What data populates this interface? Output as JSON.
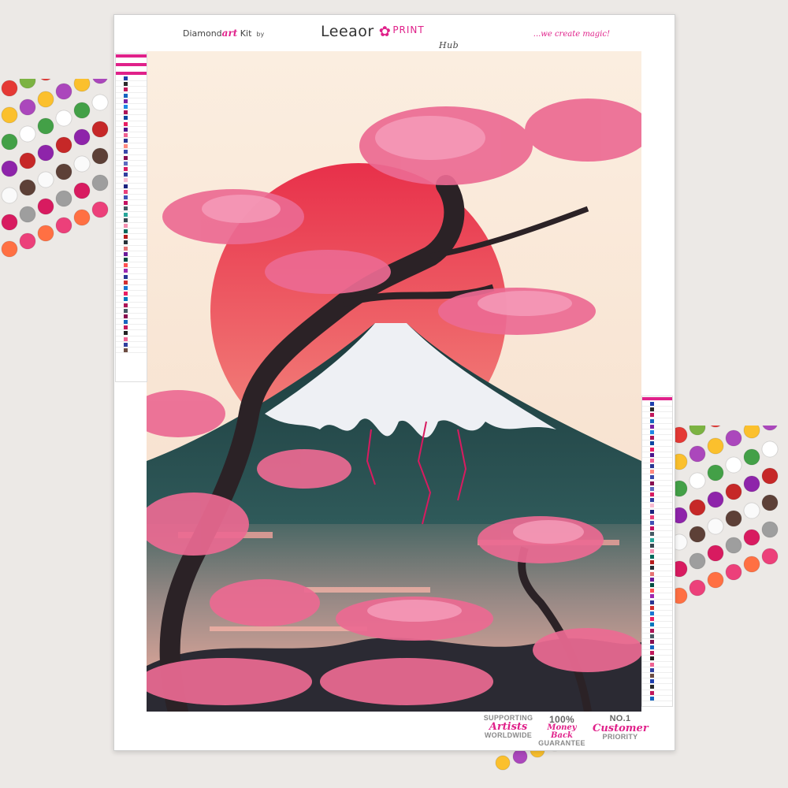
{
  "header": {
    "brand_left_prefix": "Diamond",
    "brand_left_art": "art",
    "brand_left_suffix": " Kit",
    "brand_left_by": "by",
    "brand_center_name": "Leeaor",
    "brand_center_print": "PRINT",
    "brand_center_hub": "Hub",
    "tagline": "...we create magic!"
  },
  "footer": {
    "badges": [
      {
        "top": "SUPPORTING",
        "mid": "Artists",
        "bottom": "WORLDWIDE"
      },
      {
        "top": "100%",
        "mid": "Money Back",
        "bottom": "GUARANTEE"
      },
      {
        "top": "NO.1",
        "mid": "Customer",
        "bottom": "PRIORITY"
      }
    ]
  },
  "colors": {
    "brand_pink": "#e0218a",
    "sky": "#f7e7d6",
    "sun": "#ea3e4f",
    "mountain_dark": "#234547",
    "snow": "#eef0f4",
    "blossom": "#ec6a92",
    "trunk": "#2b2226"
  },
  "legend_swatches": [
    "#1e3fae",
    "#2a2a2a",
    "#c2185b",
    "#1565c0",
    "#7b1fa2",
    "#1e88e5",
    "#ad1457",
    "#0d47a1",
    "#e91e63",
    "#4a148c",
    "#f06292",
    "#283593",
    "#ff8a80",
    "#3949ab",
    "#880e4f",
    "#5c6bc0",
    "#d81b60",
    "#303f9f",
    "#f8bbd0",
    "#1a237e",
    "#ec407a",
    "#3f51b5",
    "#c51162",
    "#455a64",
    "#26a69a",
    "#37474f",
    "#f48fb1",
    "#00695c",
    "#b71c1c",
    "#263238",
    "#e57373",
    "#6a1b9a",
    "#004d40",
    "#ff5252",
    "#9c27b0",
    "#283593",
    "#d32f2f",
    "#1976d2",
    "#e91e63",
    "#0277bd",
    "#ad1457",
    "#455a64",
    "#880e4f",
    "#1565c0",
    "#c2185b",
    "#212121",
    "#f06292",
    "#303f9f",
    "#6d4c41"
  ]
}
